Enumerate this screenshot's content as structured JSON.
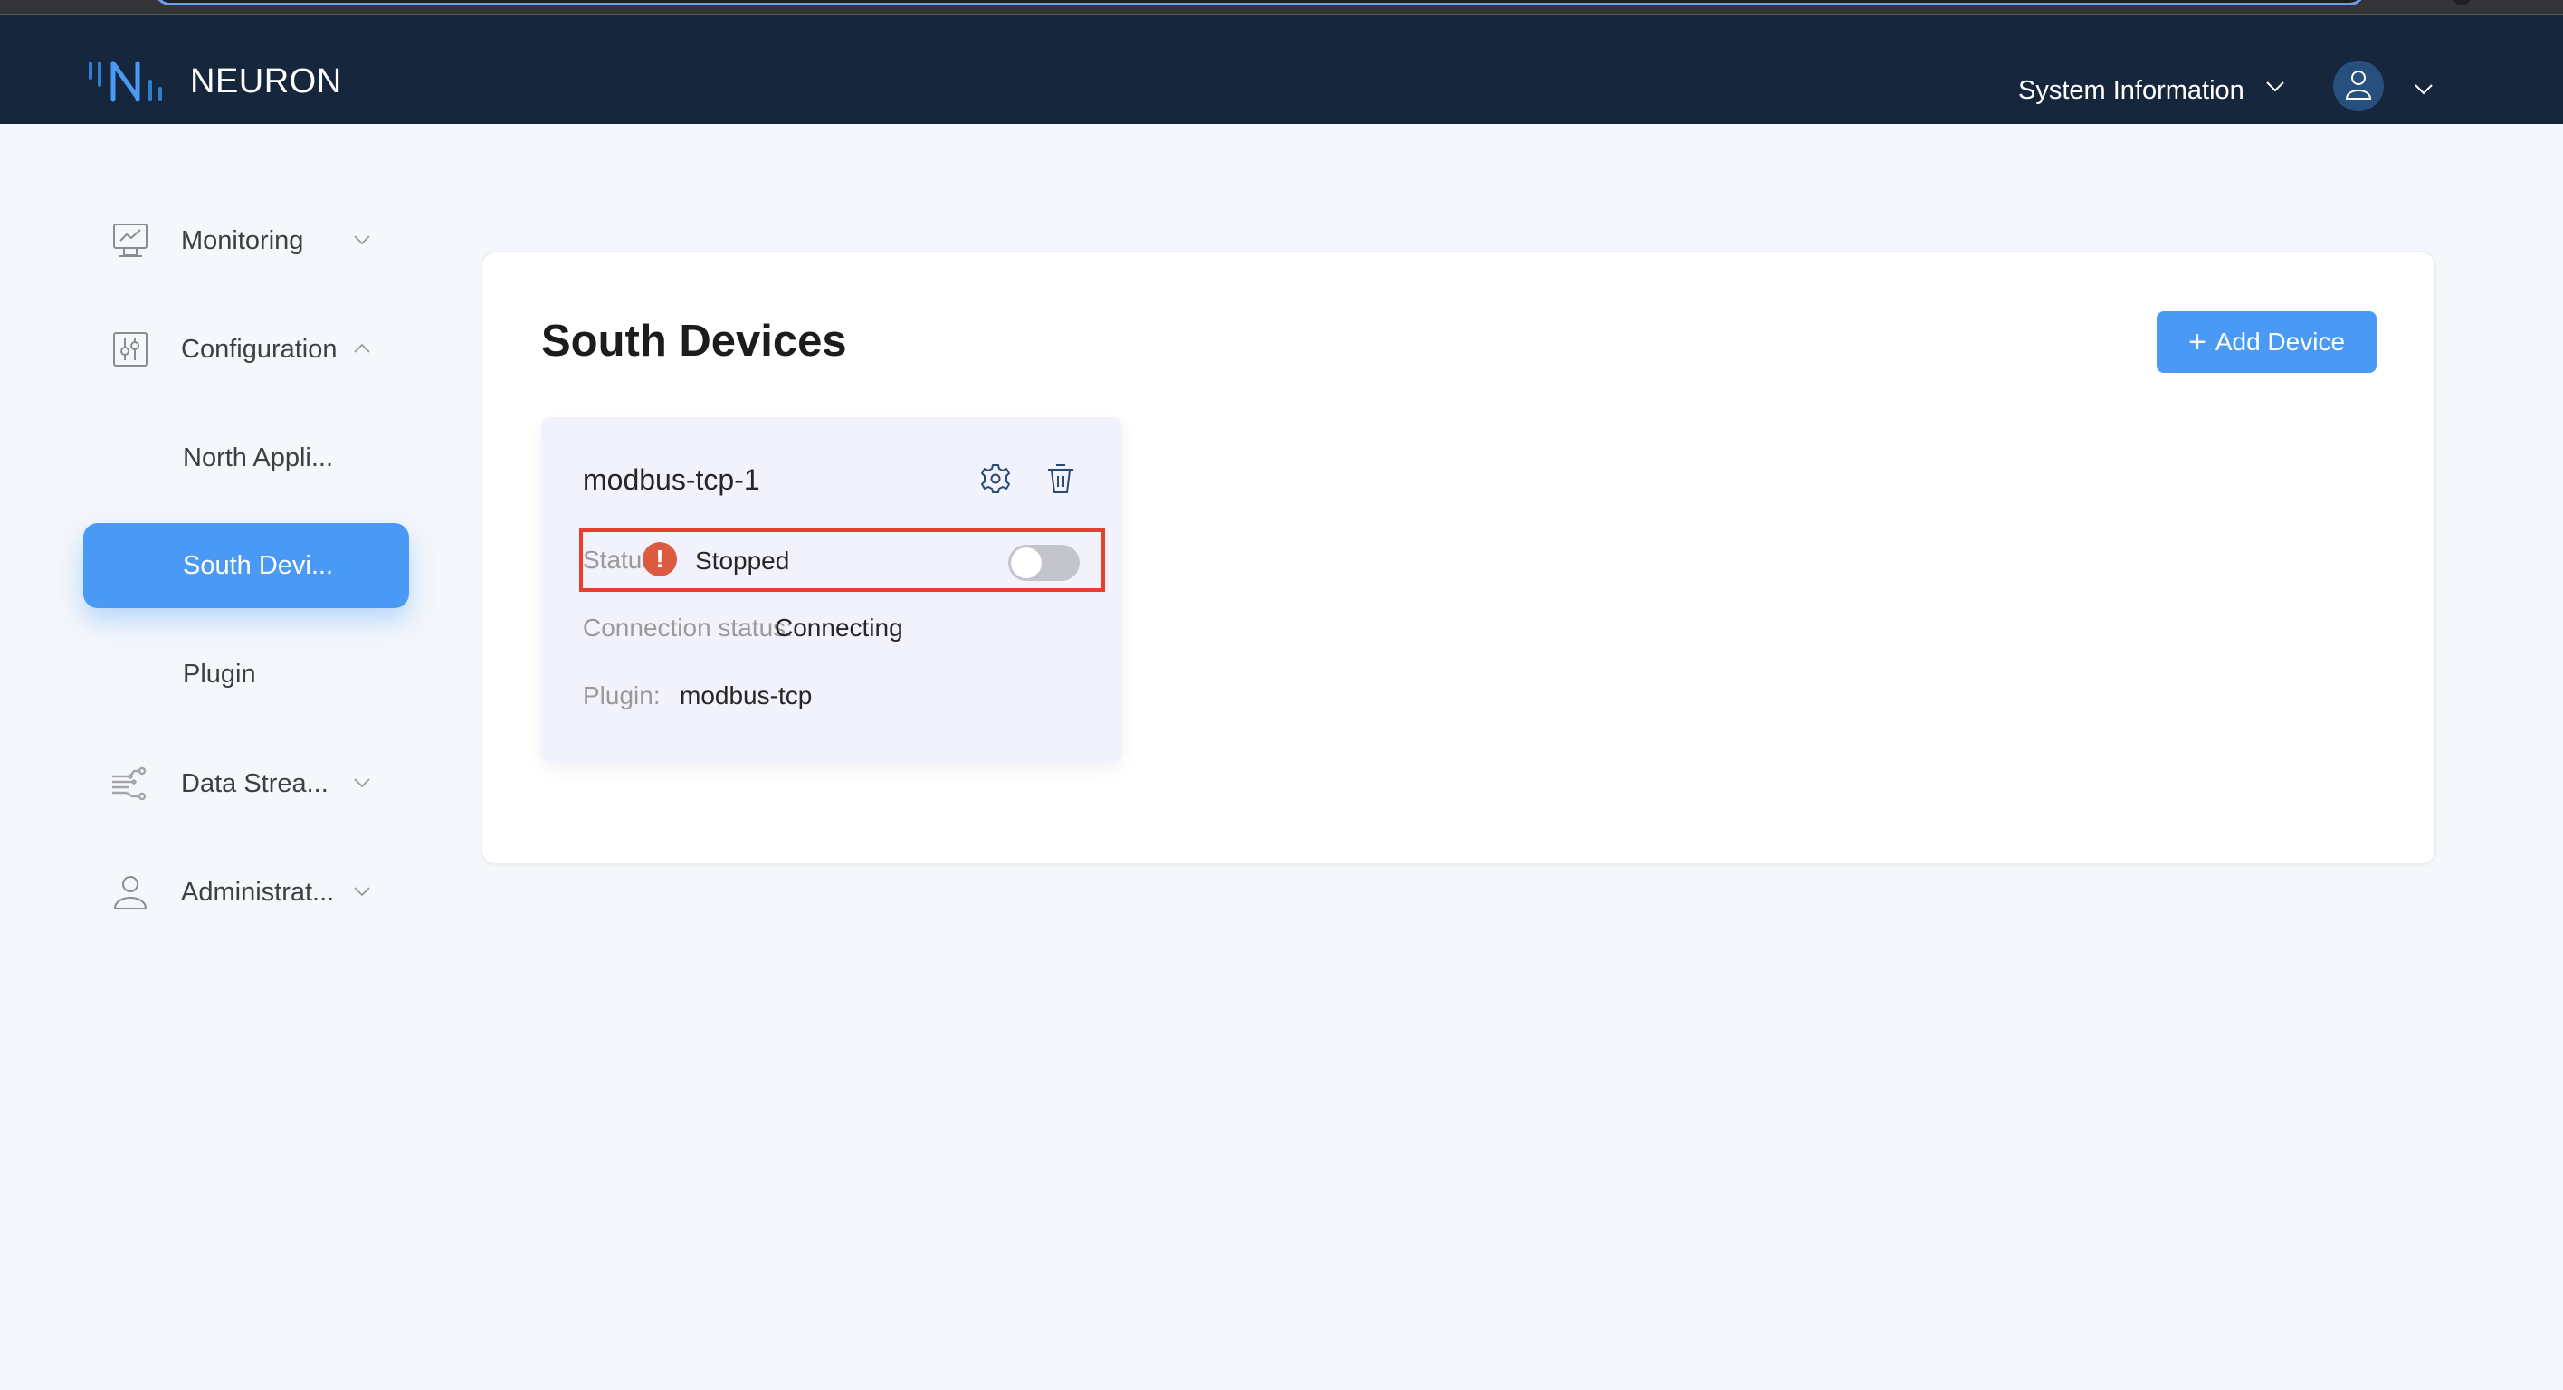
{
  "app": {
    "brand": "NEURON"
  },
  "header": {
    "system_info_label": "System Information",
    "user_menu_icon": "user-icon"
  },
  "sidebar": {
    "items": [
      {
        "label": "Monitoring",
        "icon": "monitor-chart-icon",
        "expanded": false
      },
      {
        "label": "Configuration",
        "icon": "sliders-icon",
        "expanded": true,
        "children": [
          {
            "label": "North Appli...",
            "active": false
          },
          {
            "label": "South Devi...",
            "active": true
          },
          {
            "label": "Plugin",
            "active": false
          }
        ]
      },
      {
        "label": "Data Strea...",
        "icon": "data-stream-icon",
        "expanded": false
      },
      {
        "label": "Administrat...",
        "icon": "user-icon",
        "expanded": false
      }
    ]
  },
  "main": {
    "title": "South Devices",
    "add_button_label": "Add Device",
    "devices": [
      {
        "name": "modbus-tcp-1",
        "status_label": "Status:",
        "status_value": "Stopped",
        "running": false,
        "connection_label": "Connection status:",
        "connection_value": "Connecting",
        "plugin_label": "Plugin:",
        "plugin_value": "modbus-tcp"
      }
    ]
  },
  "colors": {
    "header_bg": "#16263d",
    "accent": "#4a9af5",
    "error": "#db5a40",
    "highlight_box": "#e8402d"
  }
}
